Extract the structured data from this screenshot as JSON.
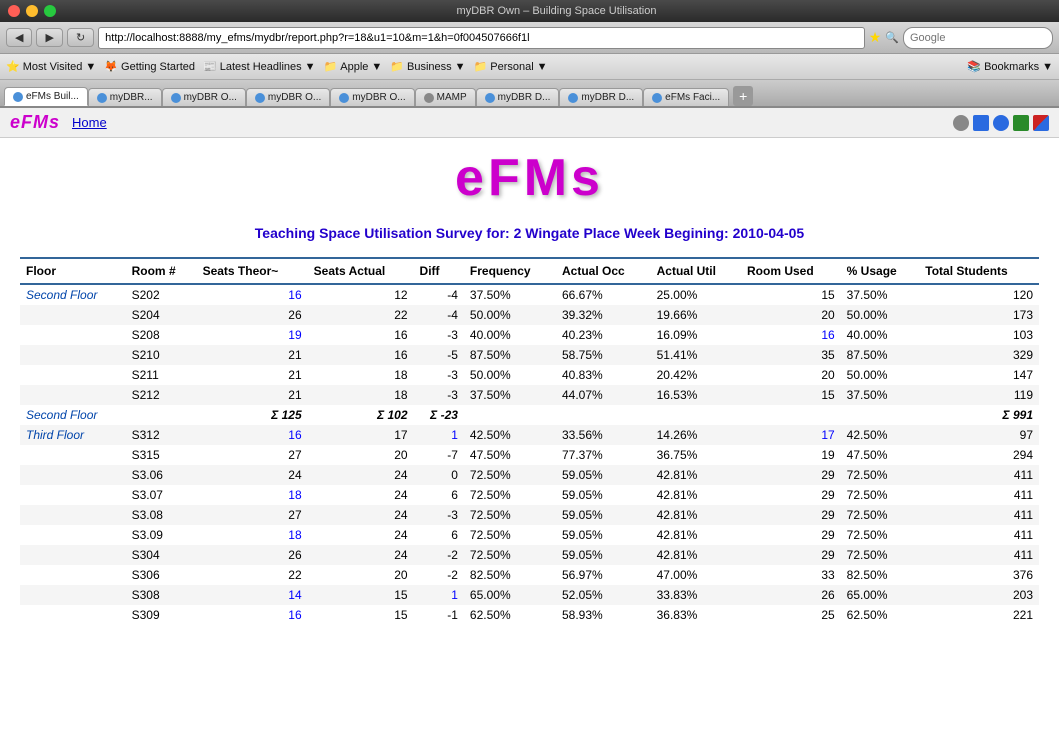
{
  "browser": {
    "title": "myDBR Own – Building Space Utilisation",
    "url": "http://localhost:8888/my_efms/mydbr/report.php?r=18&u1=10&m=1&h=0f004507666f1l",
    "tabs": [
      {
        "label": "eFMs Buil...",
        "active": true
      },
      {
        "label": "myDBR...",
        "active": false
      },
      {
        "label": "myDBR O...",
        "active": false
      },
      {
        "label": "myDBR O...",
        "active": false
      },
      {
        "label": "myDBR O...",
        "active": false
      },
      {
        "label": "MAMP",
        "active": false
      },
      {
        "label": "myDBR D...",
        "active": false
      },
      {
        "label": "myDBR D...",
        "active": false
      },
      {
        "label": "eFMs Faci...",
        "active": false
      }
    ],
    "bookmarks": [
      {
        "label": "Most Visited"
      },
      {
        "label": "Getting Started"
      },
      {
        "label": "Latest Headlines"
      },
      {
        "label": "Apple"
      },
      {
        "label": "Business"
      },
      {
        "label": "Personal"
      },
      {
        "label": "Bookmarks"
      }
    ],
    "search_placeholder": "Google"
  },
  "app": {
    "logo": "eFMs",
    "nav_home": "Home"
  },
  "page": {
    "logo": "eFMs",
    "survey_title": "Teaching Space Utilisation Survey for: 2 Wingate Place Week Begining: 2010-04-05"
  },
  "table": {
    "columns": [
      {
        "label": "Floor",
        "key": "floor"
      },
      {
        "label": "Room #",
        "key": "room"
      },
      {
        "label": "Seats Theor~",
        "key": "seats_theor"
      },
      {
        "label": "Seats Actual",
        "key": "seats_actual"
      },
      {
        "label": "Diff",
        "key": "diff"
      },
      {
        "label": "Frequency",
        "key": "frequency"
      },
      {
        "label": "Actual Occ",
        "key": "actual_occ"
      },
      {
        "label": "Actual Util",
        "key": "actual_util"
      },
      {
        "label": "Room Used",
        "key": "room_used"
      },
      {
        "label": "% Usage",
        "key": "pct_usage"
      },
      {
        "label": "Total Students",
        "key": "total_students"
      }
    ],
    "sections": [
      {
        "floor_label": "Second Floor",
        "floor_class": "floor-label",
        "rows": [
          {
            "room": "S202",
            "seats_theor": "16",
            "seats_actual": "12",
            "diff": "-4",
            "frequency": "37.50%",
            "actual_occ": "66.67%",
            "actual_util": "25.00%",
            "room_used": "15",
            "pct_usage": "37.50%",
            "total_students": "120",
            "highlight_theor": true,
            "highlight_used": false
          },
          {
            "room": "S204",
            "seats_theor": "26",
            "seats_actual": "22",
            "diff": "-4",
            "frequency": "50.00%",
            "actual_occ": "39.32%",
            "actual_util": "19.66%",
            "room_used": "20",
            "pct_usage": "50.00%",
            "total_students": "173",
            "highlight_theor": false,
            "highlight_used": false
          },
          {
            "room": "S208",
            "seats_theor": "19",
            "seats_actual": "16",
            "diff": "-3",
            "frequency": "40.00%",
            "actual_occ": "40.23%",
            "actual_util": "16.09%",
            "room_used": "16",
            "pct_usage": "40.00%",
            "total_students": "103",
            "highlight_theor": true,
            "highlight_used": true
          },
          {
            "room": "S210",
            "seats_theor": "21",
            "seats_actual": "16",
            "diff": "-5",
            "frequency": "87.50%",
            "actual_occ": "58.75%",
            "actual_util": "51.41%",
            "room_used": "35",
            "pct_usage": "87.50%",
            "total_students": "329",
            "highlight_theor": false,
            "highlight_used": false
          },
          {
            "room": "S211",
            "seats_theor": "21",
            "seats_actual": "18",
            "diff": "-3",
            "frequency": "50.00%",
            "actual_occ": "40.83%",
            "actual_util": "20.42%",
            "room_used": "20",
            "pct_usage": "50.00%",
            "total_students": "147",
            "highlight_theor": false,
            "highlight_used": false
          },
          {
            "room": "S212",
            "seats_theor": "21",
            "seats_actual": "18",
            "diff": "-3",
            "frequency": "37.50%",
            "actual_occ": "44.07%",
            "actual_util": "16.53%",
            "room_used": "15",
            "pct_usage": "37.50%",
            "total_students": "119",
            "highlight_theor": false,
            "highlight_used": false
          }
        ],
        "subtotal": {
          "label": "Second Floor",
          "seats_theor": "Σ 125",
          "seats_actual": "Σ 102",
          "diff": "Σ -23",
          "total_students": "Σ 991"
        }
      },
      {
        "floor_label": "Third Floor",
        "floor_class": "floor-label",
        "rows": [
          {
            "room": "S312",
            "seats_theor": "16",
            "seats_actual": "17",
            "diff": "1",
            "frequency": "42.50%",
            "actual_occ": "33.56%",
            "actual_util": "14.26%",
            "room_used": "17",
            "pct_usage": "42.50%",
            "total_students": "97",
            "highlight_theor": true,
            "highlight_used": true,
            "diff_highlight": true
          },
          {
            "room": "S315",
            "seats_theor": "27",
            "seats_actual": "20",
            "diff": "-7",
            "frequency": "47.50%",
            "actual_occ": "77.37%",
            "actual_util": "36.75%",
            "room_used": "19",
            "pct_usage": "47.50%",
            "total_students": "294",
            "highlight_theor": false,
            "highlight_used": false
          },
          {
            "room": "S3.06",
            "seats_theor": "24",
            "seats_actual": "24",
            "diff": "0",
            "frequency": "72.50%",
            "actual_occ": "59.05%",
            "actual_util": "42.81%",
            "room_used": "29",
            "pct_usage": "72.50%",
            "total_students": "411",
            "highlight_theor": false,
            "highlight_used": false
          },
          {
            "room": "S3.07",
            "seats_theor": "18",
            "seats_actual": "24",
            "diff": "6",
            "frequency": "72.50%",
            "actual_occ": "59.05%",
            "actual_util": "42.81%",
            "room_used": "29",
            "pct_usage": "72.50%",
            "total_students": "411",
            "highlight_theor": true,
            "highlight_used": false
          },
          {
            "room": "S3.08",
            "seats_theor": "27",
            "seats_actual": "24",
            "diff": "-3",
            "frequency": "72.50%",
            "actual_occ": "59.05%",
            "actual_util": "42.81%",
            "room_used": "29",
            "pct_usage": "72.50%",
            "total_students": "411",
            "highlight_theor": false,
            "highlight_used": false
          },
          {
            "room": "S3.09",
            "seats_theor": "18",
            "seats_actual": "24",
            "diff": "6",
            "frequency": "72.50%",
            "actual_occ": "59.05%",
            "actual_util": "42.81%",
            "room_used": "29",
            "pct_usage": "72.50%",
            "total_students": "411",
            "highlight_theor": true,
            "highlight_used": false
          },
          {
            "room": "S304",
            "seats_theor": "26",
            "seats_actual": "24",
            "diff": "-2",
            "frequency": "72.50%",
            "actual_occ": "59.05%",
            "actual_util": "42.81%",
            "room_used": "29",
            "pct_usage": "72.50%",
            "total_students": "411",
            "highlight_theor": false,
            "highlight_used": false
          },
          {
            "room": "S306",
            "seats_theor": "22",
            "seats_actual": "20",
            "diff": "-2",
            "frequency": "82.50%",
            "actual_occ": "56.97%",
            "actual_util": "47.00%",
            "room_used": "33",
            "pct_usage": "82.50%",
            "total_students": "376",
            "highlight_theor": false,
            "highlight_used": false
          },
          {
            "room": "S308",
            "seats_theor": "14",
            "seats_actual": "15",
            "diff": "1",
            "frequency": "65.00%",
            "actual_occ": "52.05%",
            "actual_util": "33.83%",
            "room_used": "26",
            "pct_usage": "65.00%",
            "total_students": "203",
            "highlight_theor": true,
            "highlight_used": false,
            "diff_highlight": true
          },
          {
            "room": "S309",
            "seats_theor": "16",
            "seats_actual": "15",
            "diff": "-1",
            "frequency": "62.50%",
            "actual_occ": "58.93%",
            "actual_util": "36.83%",
            "room_used": "25",
            "pct_usage": "62.50%",
            "total_students": "221",
            "highlight_theor": true,
            "highlight_used": false
          }
        ]
      }
    ]
  }
}
